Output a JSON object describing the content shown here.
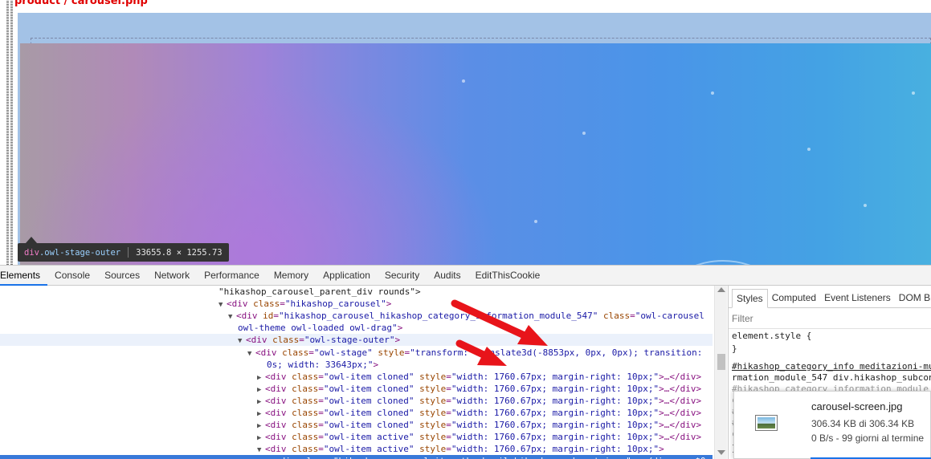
{
  "page": {
    "file_path": "product / carousel.php"
  },
  "inspector_tooltip": {
    "tag": "div",
    "class": ".owl-stage-outer",
    "dimensions": "33655.8 × 1255.73"
  },
  "devtools": {
    "tabs": [
      {
        "label": "Elements",
        "active": true
      },
      {
        "label": "Console"
      },
      {
        "label": "Sources"
      },
      {
        "label": "Network"
      },
      {
        "label": "Performance"
      },
      {
        "label": "Memory"
      },
      {
        "label": "Application"
      },
      {
        "label": "Security"
      },
      {
        "label": "Audits"
      },
      {
        "label": "EditThisCookie"
      }
    ],
    "dom_lines": [
      {
        "text": "\"hikashop_carousel_parent_div rounds\">"
      },
      {
        "tag_open": "<div ",
        "attr": "class",
        "value": "\"hikashop_carousel\"",
        "tag_close": ">"
      },
      {
        "tag_open": "<div ",
        "attr": "id",
        "value": "\"hikashop_carousel_hikashop_category_information_module_547\"",
        "attr2": " class",
        "value2": "\"owl-carousel"
      },
      {
        "value": "owl-theme owl-loaded owl-drag\"",
        "tag_close": ">"
      },
      {
        "tag_open": "<div ",
        "attr": "class",
        "value": "\"owl-stage-outer\"",
        "tag_close": ">"
      },
      {
        "tag_open": "<div ",
        "attr": "class",
        "value": "\"owl-stage\"",
        "attr2": " style",
        "value2": "\"transform: translate3d(-8853px, 0px, 0px); transition:"
      },
      {
        "value": "0s; width: 33643px;\"",
        "tag_close": ">"
      },
      {
        "tag_open": "<div ",
        "attr": "class",
        "value": "\"owl-item cloned\"",
        "attr2": " style",
        "value2": "\"width: 1760.67px; margin-right: 10px;\"",
        "tag_close": ">…</div>"
      },
      {
        "tag_open": "<div ",
        "attr": "class",
        "value": "\"owl-item cloned\"",
        "attr2": " style",
        "value2": "\"width: 1760.67px; margin-right: 10px;\"",
        "tag_close": ">…</div>"
      },
      {
        "tag_open": "<div ",
        "attr": "class",
        "value": "\"owl-item cloned\"",
        "attr2": " style",
        "value2": "\"width: 1760.67px; margin-right: 10px;\"",
        "tag_close": ">…</div>"
      },
      {
        "tag_open": "<div ",
        "attr": "class",
        "value": "\"owl-item cloned\"",
        "attr2": " style",
        "value2": "\"width: 1760.67px; margin-right: 10px;\"",
        "tag_close": ">…</div>"
      },
      {
        "tag_open": "<div ",
        "attr": "class",
        "value": "\"owl-item cloned\"",
        "attr2": " style",
        "value2": "\"width: 1760.67px; margin-right: 10px;\"",
        "tag_close": ">…</div>"
      },
      {
        "tag_open": "<div ",
        "attr": "class",
        "value": "\"owl-item active\"",
        "attr2": " style",
        "value2": "\"width: 1760.67px; margin-right: 10px;\"",
        "tag_close": ">…</div>"
      },
      {
        "tag_open": "<div ",
        "attr": "class",
        "value": "\"owl-item active\"",
        "attr2": " style",
        "value2": "\"width: 1760.67px; margin-right: 10px;\"",
        "tag_close": ">"
      },
      {
        "tag_open": "<div ",
        "attr": "class",
        "value": "\"hikashop_carousel_item_thumbnail hikashop_subcontainer\"",
        "tag_close": ">…</div> == $0"
      }
    ],
    "styles_tabs": [
      "Styles",
      "Computed",
      "Event Listeners",
      "DOM Bre"
    ],
    "filter_placeholder": "Filter",
    "style_rules": {
      "element_style_selector": "element.style {",
      "element_style_close": "}",
      "selector_line1": "#hikashop_category_info meditazioni-mu",
      "selector_line2": "rmation_module_547 div.hikashop_subcon",
      "selector_line3": "#hikashop category information module",
      "stub_c1": "c",
      "stub_hash1": "#",
      "stub_hash2": "#",
      "stub_c2": "c",
      "stub_close": "}"
    }
  },
  "download": {
    "filename": "carousel-screen.jpg",
    "size": "306.34 KB di 306.34 KB",
    "status": "0 B/s - 99 giorni al termine",
    "progress_fraction": 1.0
  },
  "colors": {
    "annotation_arrow": "#e8141a",
    "selected_row": "#3879d9",
    "file_path": "#e00000"
  }
}
